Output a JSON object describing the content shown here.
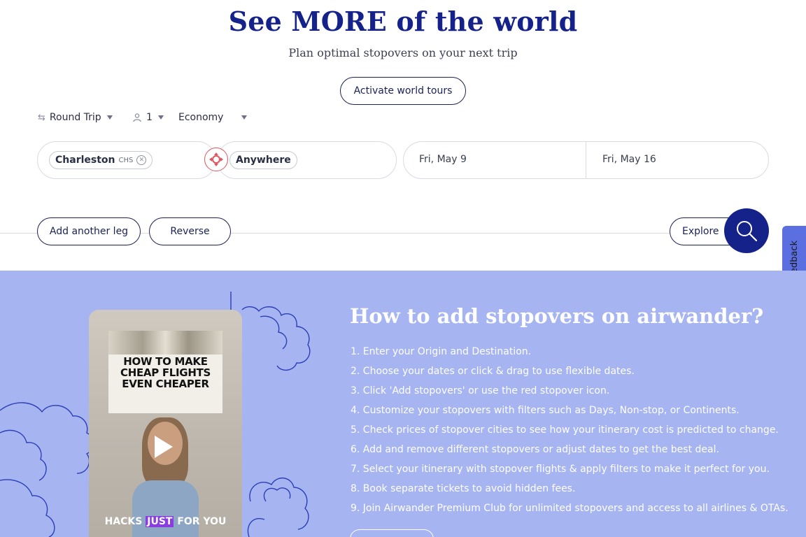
{
  "hero": {
    "title": "See MORE of the world",
    "subtitle": "Plan optimal stopovers on your next trip",
    "cta_label": "Activate world tours"
  },
  "trip_options": {
    "trip_type": "Round Trip",
    "passengers": "1",
    "cabin": "Economy"
  },
  "search": {
    "origin_city": "Charleston",
    "origin_code": "CHS",
    "destination": "Anywhere",
    "depart_date": "Fri, May 9",
    "return_date": "Fri, May 16"
  },
  "actions": {
    "add_leg_label": "Add another leg",
    "reverse_label": "Reverse",
    "explore_label": "Explore"
  },
  "feedback": {
    "label": "Feedback"
  },
  "how_to": {
    "title": "How to add stopovers on airwander?",
    "steps": [
      "1. Enter your Origin and Destination.",
      "2. Choose your dates or click & drag to use flexible dates.",
      "3. Click 'Add stopovers' or use the red stopover icon.",
      "4. Customize your stopovers with filters such as Days, Non-stop, or Continents.",
      "5. Check prices of stopover cities to see how your itinerary cost is predicted to change.",
      "6. Add and remove different stopovers or adjust dates to get the best deal.",
      "7. Select your itinerary with stopover flights & apply filters to make it perfect for you.",
      "8. Book separate tickets to avoid hidden fees.",
      "9. Join Airwander Premium Club for unlimited stopovers and access to all airlines & OTAs."
    ]
  },
  "video": {
    "poster_line1": "HOW TO MAKE",
    "poster_line2": "CHEAP FLIGHTS",
    "poster_line3": "EVEN CHEAPER",
    "caption_before": "HACKS",
    "caption_highlight": "JUST",
    "caption_after": "FOR YOU"
  },
  "colors": {
    "brand_navy": "#14228a",
    "section_bg": "#a6b4f2",
    "stopover_red": "#e0545e",
    "feedback_tab": "#5b6fe0"
  }
}
